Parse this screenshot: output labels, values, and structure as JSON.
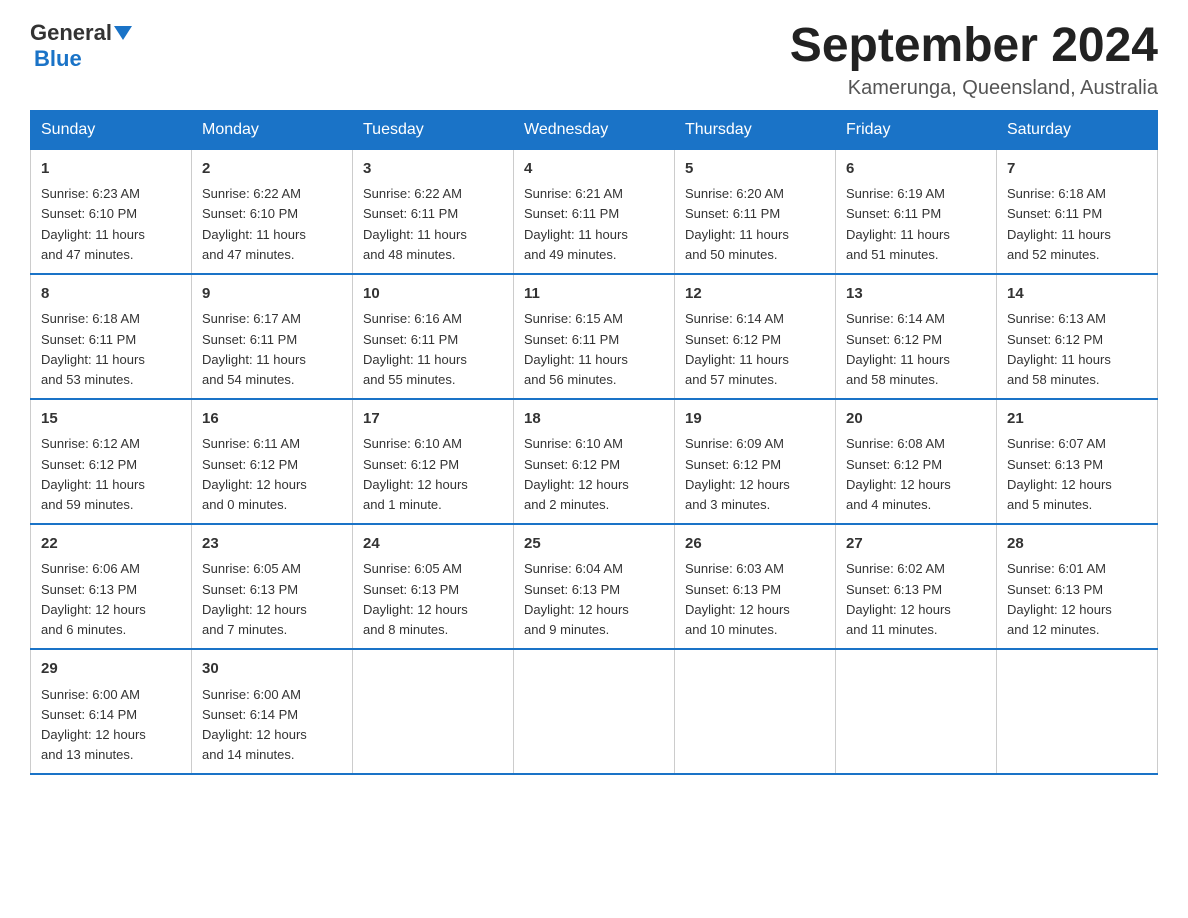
{
  "logo": {
    "text_general": "General",
    "text_blue": "Blue"
  },
  "title": "September 2024",
  "subtitle": "Kamerunga, Queensland, Australia",
  "days_of_week": [
    "Sunday",
    "Monday",
    "Tuesday",
    "Wednesday",
    "Thursday",
    "Friday",
    "Saturday"
  ],
  "weeks": [
    [
      {
        "day": "1",
        "info": "Sunrise: 6:23 AM\nSunset: 6:10 PM\nDaylight: 11 hours\nand 47 minutes."
      },
      {
        "day": "2",
        "info": "Sunrise: 6:22 AM\nSunset: 6:10 PM\nDaylight: 11 hours\nand 47 minutes."
      },
      {
        "day": "3",
        "info": "Sunrise: 6:22 AM\nSunset: 6:11 PM\nDaylight: 11 hours\nand 48 minutes."
      },
      {
        "day": "4",
        "info": "Sunrise: 6:21 AM\nSunset: 6:11 PM\nDaylight: 11 hours\nand 49 minutes."
      },
      {
        "day": "5",
        "info": "Sunrise: 6:20 AM\nSunset: 6:11 PM\nDaylight: 11 hours\nand 50 minutes."
      },
      {
        "day": "6",
        "info": "Sunrise: 6:19 AM\nSunset: 6:11 PM\nDaylight: 11 hours\nand 51 minutes."
      },
      {
        "day": "7",
        "info": "Sunrise: 6:18 AM\nSunset: 6:11 PM\nDaylight: 11 hours\nand 52 minutes."
      }
    ],
    [
      {
        "day": "8",
        "info": "Sunrise: 6:18 AM\nSunset: 6:11 PM\nDaylight: 11 hours\nand 53 minutes."
      },
      {
        "day": "9",
        "info": "Sunrise: 6:17 AM\nSunset: 6:11 PM\nDaylight: 11 hours\nand 54 minutes."
      },
      {
        "day": "10",
        "info": "Sunrise: 6:16 AM\nSunset: 6:11 PM\nDaylight: 11 hours\nand 55 minutes."
      },
      {
        "day": "11",
        "info": "Sunrise: 6:15 AM\nSunset: 6:11 PM\nDaylight: 11 hours\nand 56 minutes."
      },
      {
        "day": "12",
        "info": "Sunrise: 6:14 AM\nSunset: 6:12 PM\nDaylight: 11 hours\nand 57 minutes."
      },
      {
        "day": "13",
        "info": "Sunrise: 6:14 AM\nSunset: 6:12 PM\nDaylight: 11 hours\nand 58 minutes."
      },
      {
        "day": "14",
        "info": "Sunrise: 6:13 AM\nSunset: 6:12 PM\nDaylight: 11 hours\nand 58 minutes."
      }
    ],
    [
      {
        "day": "15",
        "info": "Sunrise: 6:12 AM\nSunset: 6:12 PM\nDaylight: 11 hours\nand 59 minutes."
      },
      {
        "day": "16",
        "info": "Sunrise: 6:11 AM\nSunset: 6:12 PM\nDaylight: 12 hours\nand 0 minutes."
      },
      {
        "day": "17",
        "info": "Sunrise: 6:10 AM\nSunset: 6:12 PM\nDaylight: 12 hours\nand 1 minute."
      },
      {
        "day": "18",
        "info": "Sunrise: 6:10 AM\nSunset: 6:12 PM\nDaylight: 12 hours\nand 2 minutes."
      },
      {
        "day": "19",
        "info": "Sunrise: 6:09 AM\nSunset: 6:12 PM\nDaylight: 12 hours\nand 3 minutes."
      },
      {
        "day": "20",
        "info": "Sunrise: 6:08 AM\nSunset: 6:12 PM\nDaylight: 12 hours\nand 4 minutes."
      },
      {
        "day": "21",
        "info": "Sunrise: 6:07 AM\nSunset: 6:13 PM\nDaylight: 12 hours\nand 5 minutes."
      }
    ],
    [
      {
        "day": "22",
        "info": "Sunrise: 6:06 AM\nSunset: 6:13 PM\nDaylight: 12 hours\nand 6 minutes."
      },
      {
        "day": "23",
        "info": "Sunrise: 6:05 AM\nSunset: 6:13 PM\nDaylight: 12 hours\nand 7 minutes."
      },
      {
        "day": "24",
        "info": "Sunrise: 6:05 AM\nSunset: 6:13 PM\nDaylight: 12 hours\nand 8 minutes."
      },
      {
        "day": "25",
        "info": "Sunrise: 6:04 AM\nSunset: 6:13 PM\nDaylight: 12 hours\nand 9 minutes."
      },
      {
        "day": "26",
        "info": "Sunrise: 6:03 AM\nSunset: 6:13 PM\nDaylight: 12 hours\nand 10 minutes."
      },
      {
        "day": "27",
        "info": "Sunrise: 6:02 AM\nSunset: 6:13 PM\nDaylight: 12 hours\nand 11 minutes."
      },
      {
        "day": "28",
        "info": "Sunrise: 6:01 AM\nSunset: 6:13 PM\nDaylight: 12 hours\nand 12 minutes."
      }
    ],
    [
      {
        "day": "29",
        "info": "Sunrise: 6:00 AM\nSunset: 6:14 PM\nDaylight: 12 hours\nand 13 minutes."
      },
      {
        "day": "30",
        "info": "Sunrise: 6:00 AM\nSunset: 6:14 PM\nDaylight: 12 hours\nand 14 minutes."
      },
      {
        "day": "",
        "info": ""
      },
      {
        "day": "",
        "info": ""
      },
      {
        "day": "",
        "info": ""
      },
      {
        "day": "",
        "info": ""
      },
      {
        "day": "",
        "info": ""
      }
    ]
  ]
}
